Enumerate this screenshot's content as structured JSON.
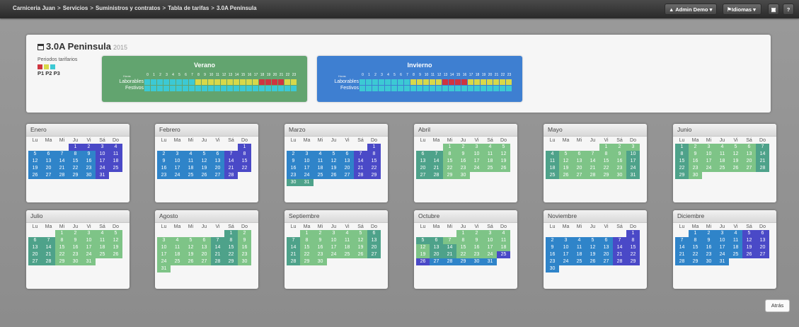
{
  "breadcrumb": [
    "Carniceria Juan",
    "Servicios",
    "Suministros y contratos",
    "Tabla de tarifas",
    "3.0A Península"
  ],
  "topbar": {
    "admin_label": "Admin Demo ▾",
    "lang_label": "Idiomas ▾",
    "help_label": "?"
  },
  "tariff": {
    "title": "3.0A Peninsula",
    "year": "2015",
    "periods_label": "Periodos tarifarios",
    "periods": [
      "P1",
      "P2",
      "P3"
    ],
    "period_colors": {
      "P1": "#cf3540",
      "P2": "#d8d84a",
      "P3": "#3cc9d4"
    }
  },
  "seasons": {
    "summer": {
      "title": "Verano",
      "hours_label": "Horas",
      "hours": [
        "0",
        "1",
        "2",
        "3",
        "4",
        "5",
        "6",
        "7",
        "8",
        "9",
        "10",
        "11",
        "12",
        "13",
        "14",
        "15",
        "16",
        "17",
        "18",
        "19",
        "20",
        "21",
        "22",
        "23"
      ],
      "rows": [
        {
          "label": "Laborables",
          "periods": [
            "P3",
            "P3",
            "P3",
            "P3",
            "P3",
            "P3",
            "P3",
            "P3",
            "P2",
            "P2",
            "P2",
            "P2",
            "P2",
            "P2",
            "P2",
            "P2",
            "P2",
            "P2",
            "P1",
            "P1",
            "P1",
            "P1",
            "P2",
            "P2"
          ]
        },
        {
          "label": "Festivos",
          "periods": [
            "P3",
            "P3",
            "P3",
            "P3",
            "P3",
            "P3",
            "P3",
            "P3",
            "P3",
            "P3",
            "P3",
            "P3",
            "P3",
            "P3",
            "P3",
            "P3",
            "P3",
            "P3",
            "P3",
            "P3",
            "P3",
            "P3",
            "P3",
            "P3"
          ]
        }
      ]
    },
    "winter": {
      "title": "Invierno",
      "hours_label": "Horas",
      "hours": [
        "0",
        "1",
        "2",
        "3",
        "4",
        "5",
        "6",
        "7",
        "8",
        "9",
        "10",
        "11",
        "12",
        "13",
        "14",
        "15",
        "16",
        "17",
        "18",
        "19",
        "20",
        "21",
        "22",
        "23"
      ],
      "rows": [
        {
          "label": "Laborables",
          "periods": [
            "P3",
            "P3",
            "P3",
            "P3",
            "P3",
            "P3",
            "P3",
            "P3",
            "P2",
            "P2",
            "P2",
            "P2",
            "P2",
            "P1",
            "P1",
            "P1",
            "P1",
            "P2",
            "P2",
            "P2",
            "P2",
            "P2",
            "P2",
            "P2"
          ]
        },
        {
          "label": "Festivos",
          "periods": [
            "P3",
            "P3",
            "P3",
            "P3",
            "P3",
            "P3",
            "P3",
            "P3",
            "P3",
            "P3",
            "P3",
            "P3",
            "P3",
            "P3",
            "P3",
            "P3",
            "P3",
            "P3",
            "P3",
            "P3",
            "P3",
            "P3",
            "P3",
            "P3"
          ]
        }
      ]
    }
  },
  "weekdays": [
    "Lu",
    "Ma",
    "Mi",
    "Ju",
    "Vi",
    "Sá",
    "Do"
  ],
  "day_type_colors": {
    "w": "#4a49c7",
    "g": "#4ea28a",
    "b": "#2f84c9",
    "l": "#7ec487"
  },
  "months": [
    {
      "name": "Enero",
      "offset": 3,
      "days": 31,
      "types": "wwwwbbbbbwwbbbbbwwbbbbbwwbbbbbw"
    },
    {
      "name": "Febrero",
      "offset": 6,
      "days": 28,
      "types": "wbbbbbwwbbbbbwwbbbbbwwbbbbbw"
    },
    {
      "name": "Marzo",
      "offset": 6,
      "days": 31,
      "types": "wbbbbbwwbbbbbwwbbbbbwwbbbbbwwgg"
    },
    {
      "name": "Abril",
      "offset": 2,
      "days": 30,
      "types": "lllllgglllllgglllllgglllllgglll"
    },
    {
      "name": "Mayo",
      "offset": 4,
      "days": 31,
      "types": "lllglllllgglllllgglllllgglllllg"
    },
    {
      "name": "Junio",
      "offset": 0,
      "days": 30,
      "types": "glllllgglllllgglllllgglllllggl"
    },
    {
      "name": "Julio",
      "offset": 2,
      "days": 31,
      "types": "lllllgglllllgglllllgglllllggllll"
    },
    {
      "name": "Agosto",
      "offset": 5,
      "days": 31,
      "types": "glllllgglllllgglllllgglllllgglll"
    },
    {
      "name": "Septiembre",
      "offset": 1,
      "days": 30,
      "types": "lllllgglllllgglllllgglllllggl"
    },
    {
      "name": "Octubre",
      "offset": 3,
      "days": 31,
      "types": "llllggllllllgglllllgglllwwbbbbbw"
    },
    {
      "name": "Noviembre",
      "offset": 6,
      "days": 30,
      "types": "wbbbbbwwbbbbbwwbbbbbwwbbbbbwwbb"
    },
    {
      "name": "Diciembre",
      "offset": 1,
      "days": 31,
      "types": "bbbbwwbbbbbwwbbbbbwwbbbbbwwbbbb"
    }
  ],
  "back_label": "Atrás"
}
